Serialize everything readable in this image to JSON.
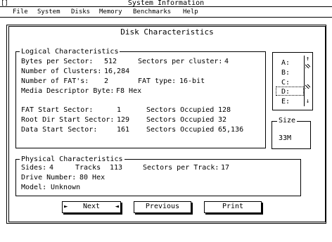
{
  "titlebar": {
    "system_box": "[]",
    "title": "System Information"
  },
  "menubar": {
    "items": [
      "File",
      "System",
      "Disks",
      "Memory",
      "Benchmarks",
      "Help"
    ]
  },
  "dialog": {
    "title": "Disk Characteristics"
  },
  "logical": {
    "label": "Logical Characteristics",
    "bytes_per_sector_label": "Bytes per Sector:",
    "bytes_per_sector_value": "512",
    "sectors_per_cluster_label": "Sectors per cluster:",
    "sectors_per_cluster_value": "4",
    "num_clusters_label": "Number of Clusters:",
    "num_clusters_value": "16,284",
    "num_fats_label": "Number of FAT's:",
    "num_fats_value": "2",
    "fat_type_label": "FAT type:",
    "fat_type_value": "16-bit",
    "media_descriptor_label": "Media Descriptor Byte:",
    "media_descriptor_value": "F8 Hex",
    "fat_start_label": "FAT Start Sector:",
    "fat_start_value": "1",
    "fat_occupied_label": "Sectors Occupied",
    "fat_occupied_value": "128",
    "root_start_label": "Root Dir Start Sector:",
    "root_start_value": "129",
    "root_occupied_label": "Sectors Occupied",
    "root_occupied_value": "32",
    "data_start_label": "Data Start Sector:",
    "data_start_value": "161",
    "data_occupied_label": "Sectors Occupied",
    "data_occupied_value": "65,136"
  },
  "drives": {
    "items": [
      "A:",
      "B:",
      "C:",
      "D:",
      "E:"
    ],
    "selected": "D:",
    "up_arrow": "↑",
    "down_arrow": "↓"
  },
  "size": {
    "label": "Size",
    "value": "33M"
  },
  "physical": {
    "label": "Physical Characteristics",
    "sides_label": "Sides:",
    "sides_value": "4",
    "tracks_label": "Tracks",
    "tracks_value": "113",
    "sectors_per_track_label": "Sectors per Track:",
    "sectors_per_track_value": "17",
    "drive_number_label": "Drive Number:",
    "drive_number_value": "80 Hex",
    "model_label": "Model:",
    "model_value": "Unknown"
  },
  "buttons": {
    "next": "Next",
    "previous": "Previous",
    "print": "Print"
  }
}
